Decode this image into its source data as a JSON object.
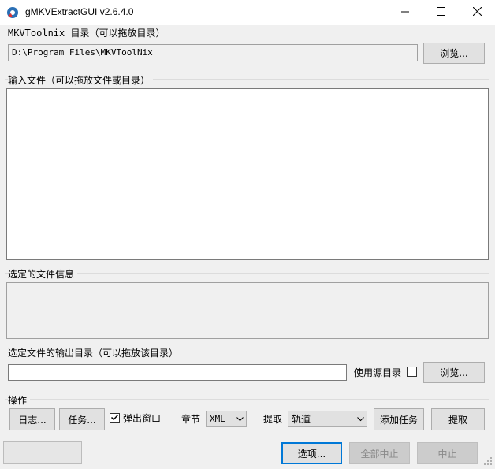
{
  "window": {
    "title": "gMKVExtractGUI v2.6.4.0",
    "icons": {
      "app": "app-icon",
      "minimize": "minimize-icon",
      "maximize": "maximize-icon",
      "close": "close-icon"
    }
  },
  "mkvtoolnix": {
    "label": "MKVToolnix 目录（可以拖放目录）",
    "path_value": "D:\\Program Files\\MKVToolNix",
    "browse_label": "浏览..."
  },
  "input": {
    "label": "输入文件（可以拖放文件或目录）"
  },
  "fileinfo": {
    "label": "选定的文件信息"
  },
  "output": {
    "label": "选定文件的输出目录（可以拖放该目录）",
    "path_value": "",
    "use_source_label": "使用源目录",
    "use_source_checked": false,
    "browse_label": "浏览..."
  },
  "actions": {
    "label": "操作",
    "log_label": "日志...",
    "jobs_label": "任务...",
    "popup_label": "弹出窗口",
    "popup_checked": true,
    "chapter_label": "章节",
    "chapter_value": "XML",
    "extract_label": "提取",
    "extract_value": "轨道",
    "add_job_label": "添加任务",
    "extract_button_label": "提取"
  },
  "bottom": {
    "options_label": "选项...",
    "abort_all_label": "全部中止",
    "abort_label": "中止"
  }
}
